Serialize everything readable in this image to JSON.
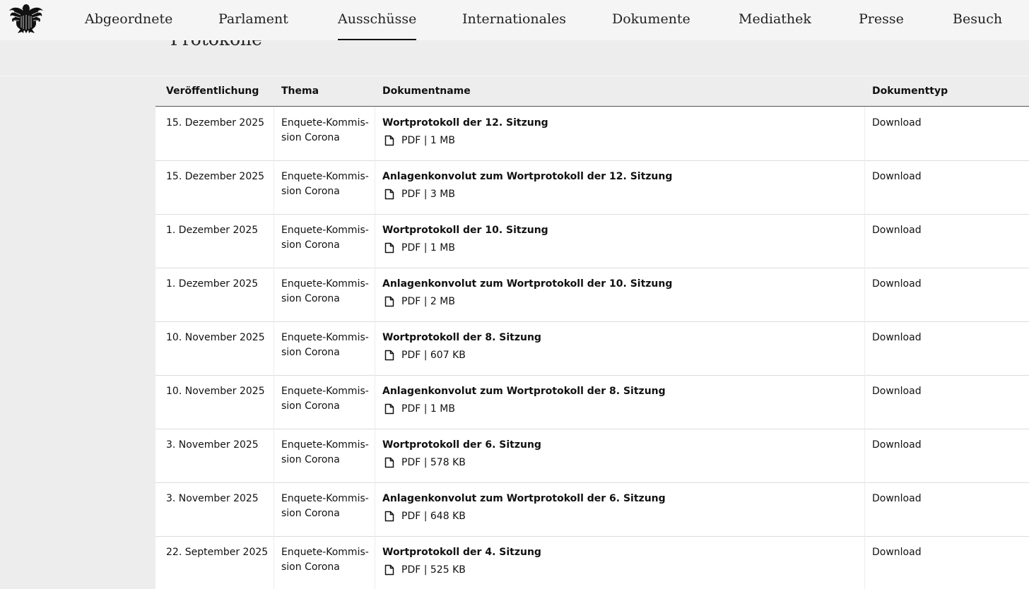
{
  "nav": {
    "logo": "bundesadler-logo",
    "items": [
      {
        "label": "Abgeordnete"
      },
      {
        "label": "Parlament"
      },
      {
        "label": "Ausschüsse",
        "active": true
      },
      {
        "label": "Internationales"
      },
      {
        "label": "Dokumente"
      },
      {
        "label": "Mediathek"
      },
      {
        "label": "Presse"
      },
      {
        "label": "Besuch"
      }
    ]
  },
  "page": {
    "title": "Protokolle"
  },
  "table": {
    "headers": {
      "date": "Veröffentlichung",
      "thema": "Thema",
      "doc": "Dokumentname",
      "type": "Dokumenttyp"
    },
    "rows": [
      {
        "date": "15. Dezember 2025",
        "thema": "Enquete-Kommis-sion Corona",
        "doc_title": "Wortprotokoll der 12. Sitzung",
        "doc_meta": "PDF | 1 MB",
        "type": "Download"
      },
      {
        "date": "15. Dezember 2025",
        "thema": "Enquete-Kommis-sion Corona",
        "doc_title": "Anlagenkonvolut zum Wortprotokoll der 12. Sitzung",
        "doc_meta": "PDF | 3 MB",
        "type": "Download"
      },
      {
        "date": "1. Dezember 2025",
        "thema": "Enquete-Kommis-sion Corona",
        "doc_title": "Wortprotokoll der 10. Sitzung",
        "doc_meta": "PDF | 1 MB",
        "type": "Download"
      },
      {
        "date": "1. Dezember 2025",
        "thema": "Enquete-Kommis-sion Corona",
        "doc_title": "Anlagenkonvolut zum Wortprotokoll der 10. Sitzung",
        "doc_meta": "PDF | 2 MB",
        "type": "Download"
      },
      {
        "date": "10. November 2025",
        "thema": "Enquete-Kommis-sion Corona",
        "doc_title": "Wortprotokoll der 8. Sitzung",
        "doc_meta": "PDF | 607 KB",
        "type": "Download"
      },
      {
        "date": "10. November 2025",
        "thema": "Enquete-Kommis-sion Corona",
        "doc_title": "Anlagenkonvolut zum Wortprotokoll der 8. Sitzung",
        "doc_meta": "PDF | 1 MB",
        "type": "Download"
      },
      {
        "date": "3. November 2025",
        "thema": "Enquete-Kommis-sion Corona",
        "doc_title": "Wortprotokoll der 6. Sitzung",
        "doc_meta": "PDF | 578 KB",
        "type": "Download"
      },
      {
        "date": "3. November 2025",
        "thema": "Enquete-Kommis-sion Corona",
        "doc_title": "Anlagenkonvolut zum Wortprotokoll der 6. Sitzung",
        "doc_meta": "PDF | 648 KB",
        "type": "Download"
      },
      {
        "date": "22. September 2025",
        "thema": "Enquete-Kommis-sion Corona",
        "doc_title": "Wortprotokoll der 4. Sitzung",
        "doc_meta": "PDF | 525 KB",
        "type": "Download"
      }
    ],
    "row_icon": "document-icon"
  }
}
